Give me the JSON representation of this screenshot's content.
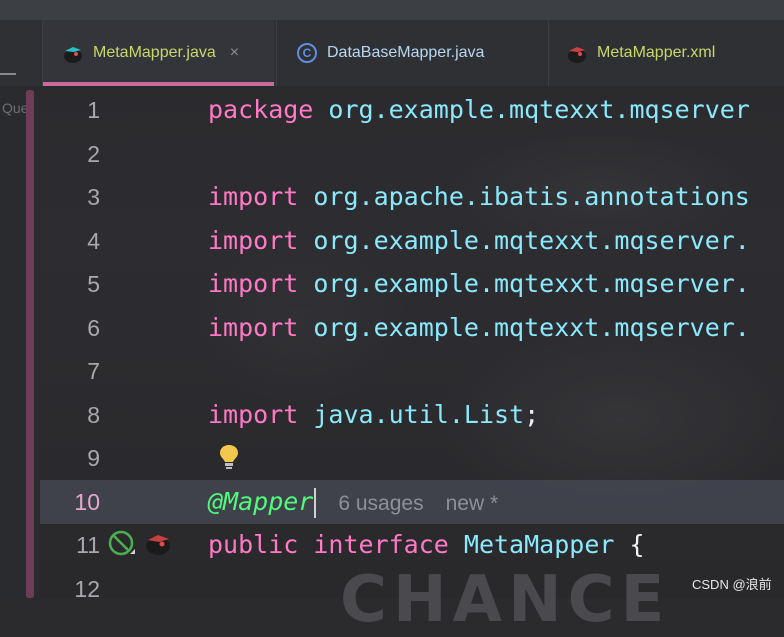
{
  "tabs": [
    {
      "label": "MetaMapper.java",
      "icon": "mybatis-bird-icon",
      "active": true,
      "close": "×"
    },
    {
      "label": "DataBaseMapper.java",
      "icon": "class-icon",
      "icon_glyph": "C"
    },
    {
      "label": "MetaMapper.xml",
      "icon": "mybatis-bird-icon"
    }
  ],
  "left_panel_label": "Quei",
  "code_lines": [
    {
      "n": "1",
      "kw": "package",
      "text": "org.example.mqtexxt.mqserver"
    },
    {
      "n": "2"
    },
    {
      "n": "3",
      "kw": "import",
      "text": "org.apache.ibatis.annotations"
    },
    {
      "n": "4",
      "kw": "import",
      "text": "org.example.mqtexxt.mqserver."
    },
    {
      "n": "5",
      "kw": "import",
      "text": "org.example.mqtexxt.mqserver."
    },
    {
      "n": "6",
      "kw": "import",
      "text": "org.example.mqtexxt.mqserver."
    },
    {
      "n": "7"
    },
    {
      "n": "8",
      "kw": "import",
      "text": "java.util.List",
      "punct": ";"
    },
    {
      "n": "9"
    },
    {
      "n": "10",
      "annotation": "@Mapper",
      "usages": "6 usages",
      "status": "new *"
    },
    {
      "n": "11",
      "kw1": "public",
      "kw2": "interface",
      "cls": "MetaMapper",
      "punct": "{"
    },
    {
      "n": "12"
    }
  ],
  "watermark": "CSDN @浪前",
  "background_text": "CHANCE",
  "colors": {
    "keyword": "#ff79c6",
    "package": "#8be9fd",
    "annotation": "#50fa7b",
    "active_tab_underline": "#c96a9b",
    "tab_label": "#c9d76a"
  }
}
